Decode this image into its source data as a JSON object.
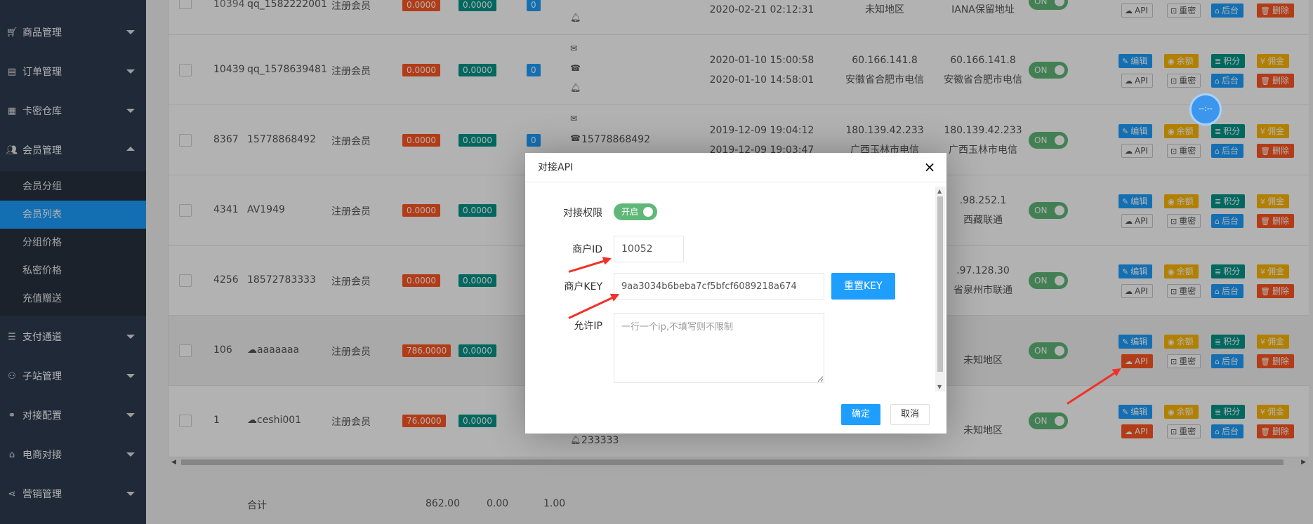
{
  "sidebar": {
    "items": [
      {
        "label": "商品管理",
        "icon": "cart-icon"
      },
      {
        "label": "订单管理",
        "icon": "clipboard-icon"
      },
      {
        "label": "卡密仓库",
        "icon": "card-icon"
      },
      {
        "label": "会员管理",
        "icon": "users-icon"
      },
      {
        "label": "支付通道",
        "icon": "list-icon"
      },
      {
        "label": "子站管理",
        "icon": "sitemap-icon"
      },
      {
        "label": "对接配置",
        "icon": "link-icon"
      },
      {
        "label": "电商对接",
        "icon": "bag-icon"
      },
      {
        "label": "营销管理",
        "icon": "share-icon"
      }
    ],
    "sub_items": [
      "会员分组",
      "会员列表",
      "分组价格",
      "私密价格",
      "充值赠送"
    ]
  },
  "table": {
    "rows": [
      {
        "id": "10394",
        "name": "qq_1582222001",
        "group": "注册会员",
        "balance": "0.0000",
        "points": "0.0000",
        "count": "0",
        "contact_phone": "",
        "date1": "2020-02-21 02:12:31",
        "date2": "",
        "ip1": "未知地区",
        "ip1_loc": "",
        "ip2": "IANA保留地址",
        "ip2_loc": "",
        "switch": "ON"
      },
      {
        "id": "10439",
        "name": "qq_1578639481",
        "group": "注册会员",
        "balance": "0.0000",
        "points": "0.0000",
        "count": "0",
        "contact_phone": "",
        "date1": "2020-01-10 15:00:58",
        "date2": "2020-01-10 14:58:01",
        "ip1": "60.166.141.8",
        "ip1_loc": "安徽省合肥市电信",
        "ip2": "60.166.141.8",
        "ip2_loc": "安徽省合肥市电信",
        "switch": "ON"
      },
      {
        "id": "8367",
        "name": "15778868492",
        "group": "注册会员",
        "balance": "0.0000",
        "points": "0.0000",
        "count": "0",
        "contact_phone": "15778868492",
        "date1": "2019-12-09 19:04:12",
        "date2": "2019-12-09 19:03:47",
        "ip1": "180.139.42.233",
        "ip1_loc": "广西玉林市电信",
        "ip2": "180.139.42.233",
        "ip2_loc": "广西玉林市电信",
        "switch": "ON"
      },
      {
        "id": "4341",
        "name": "AV1949",
        "group": "注册会员",
        "balance": "0.0000",
        "points": "0.0000",
        "count": "",
        "contact_phone": "",
        "date1": "",
        "date2": "",
        "ip1": "",
        "ip1_loc": "",
        "ip2": ".98.252.1",
        "ip2_loc": "西藏联通",
        "switch": "ON"
      },
      {
        "id": "4256",
        "name": "18572783333",
        "group": "注册会员",
        "balance": "0.0000",
        "points": "0.0000",
        "count": "",
        "contact_phone": "",
        "date1": "",
        "date2": "",
        "ip1": "",
        "ip1_loc": "",
        "ip2": ".97.128.30",
        "ip2_loc": "省泉州市联通",
        "switch": "ON"
      },
      {
        "id": "106",
        "name": "aaaaaaa",
        "group": "注册会员",
        "balance": "786.0000",
        "points": "0.0000",
        "count": "",
        "contact_phone": "",
        "date1": "",
        "date2": "",
        "ip1": "",
        "ip1_loc": "",
        "ip2": "未知地区",
        "ip2_loc": "",
        "switch": "ON"
      },
      {
        "id": "1",
        "name": "ceshi001",
        "group": "注册会员",
        "balance": "76.0000",
        "points": "0.0000",
        "count": "",
        "contact_phone": "233333",
        "date1": "",
        "date2": "",
        "ip1": "",
        "ip1_loc": "",
        "ip2": "未知地区",
        "ip2_loc": "",
        "switch": "ON"
      }
    ],
    "actions": {
      "edit": "编辑",
      "balance": "余额",
      "points": "积分",
      "commission": "佣金",
      "api": "API",
      "reset": "重密",
      "backend": "后台",
      "delete": "删除"
    }
  },
  "footer": {
    "label": "合计",
    "total1": "862.00",
    "total2": "0.00",
    "total3": "1.00"
  },
  "modal": {
    "title": "对接API",
    "perm_label": "对接权限",
    "perm_toggle": "开启",
    "merchant_id_label": "商户ID",
    "merchant_id_value": "10052",
    "merchant_key_label": "商户KEY",
    "merchant_key_value": "9aa3034b6beba7cf5bfcf6089218a674",
    "reset_key_label": "重置KEY",
    "allow_ip_label": "允许IP",
    "allow_ip_placeholder": "一行一个ip,不填写则不限制",
    "confirm_label": "确定",
    "cancel_label": "取消"
  },
  "cursor": {
    "label": "--:--"
  },
  "colors": {
    "sidebar": "#2f3c51",
    "active": "#1e9fff",
    "red": "#ff5722",
    "green": "#009688",
    "yellow": "#ffb800",
    "switch": "#5fb878"
  }
}
